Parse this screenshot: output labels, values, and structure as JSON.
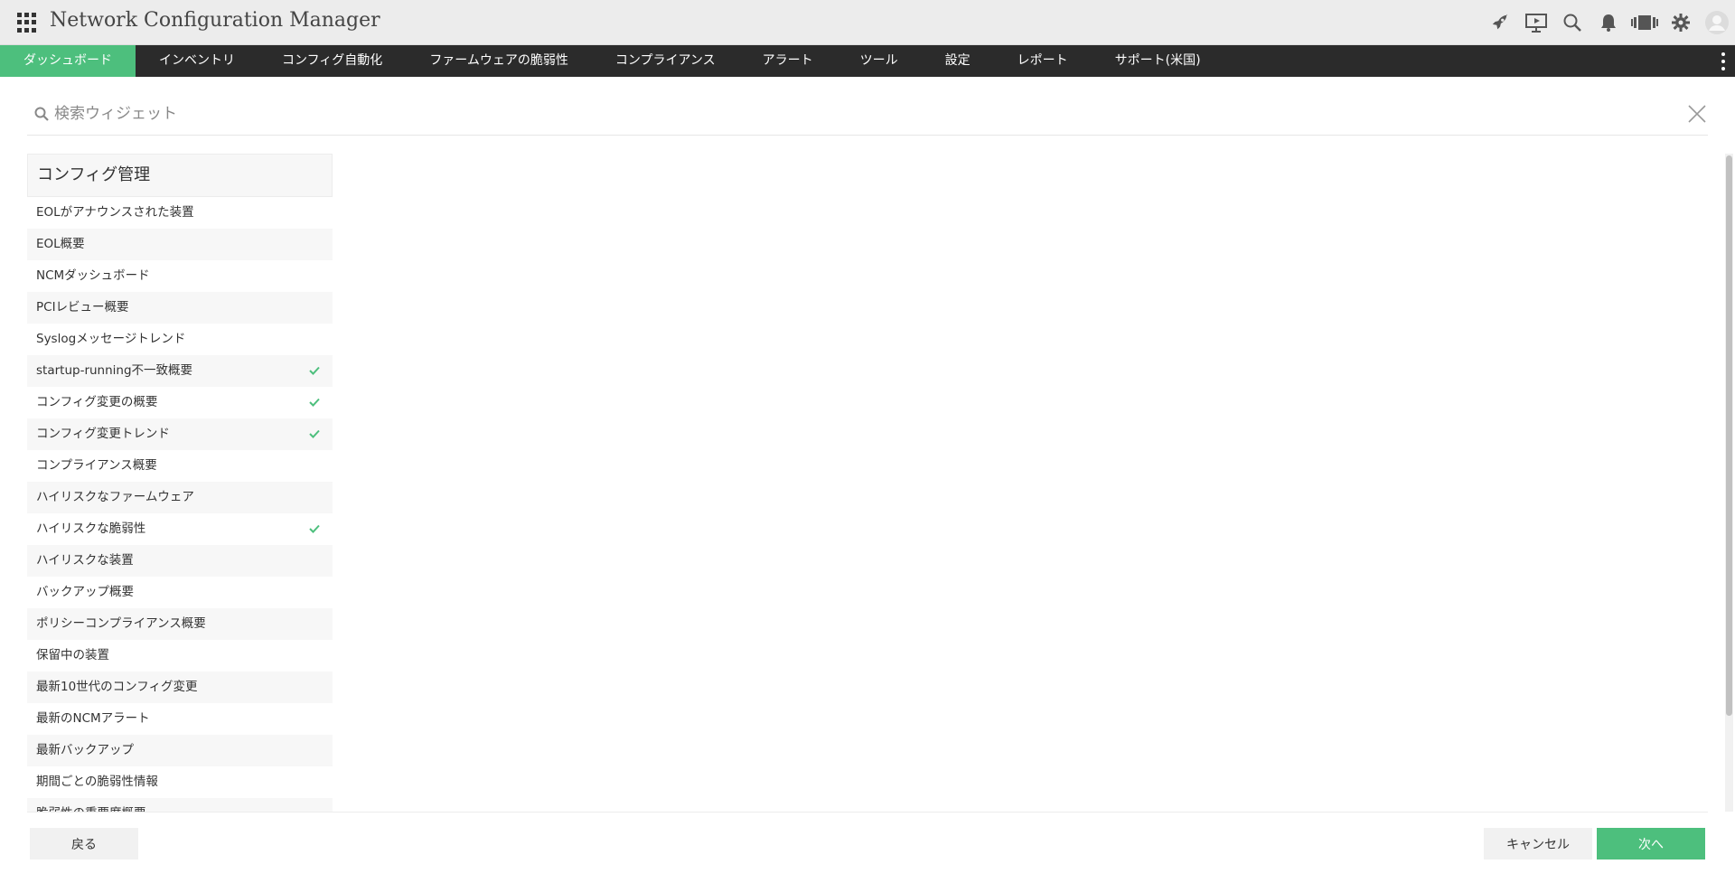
{
  "header": {
    "title": "Network Configuration Manager",
    "icons": [
      "rocket-icon",
      "presentation-icon",
      "search-icon",
      "bell-icon",
      "carousel-icon",
      "gear-icon",
      "user-avatar-icon"
    ]
  },
  "nav": {
    "items": [
      {
        "label": "ダッシュボード",
        "active": true
      },
      {
        "label": "インベントリ"
      },
      {
        "label": "コンフィグ自動化"
      },
      {
        "label": "ファームウェアの脆弱性"
      },
      {
        "label": "コンプライアンス"
      },
      {
        "label": "アラート"
      },
      {
        "label": "ツール"
      },
      {
        "label": "設定"
      },
      {
        "label": "レポート"
      },
      {
        "label": "サポート(米国)"
      }
    ]
  },
  "search": {
    "placeholder": "検索ウィジェット",
    "value": ""
  },
  "category": {
    "title": "コンフィグ管理"
  },
  "widgets": [
    {
      "label": "EOLがアナウンスされた装置",
      "checked": false
    },
    {
      "label": "EOL概要",
      "checked": false
    },
    {
      "label": "NCMダッシュボード",
      "checked": false
    },
    {
      "label": "PCIレビュー概要",
      "checked": false
    },
    {
      "label": "Syslogメッセージトレンド",
      "checked": false
    },
    {
      "label": "startup-running不一致概要",
      "checked": true
    },
    {
      "label": "コンフィグ変更の概要",
      "checked": true
    },
    {
      "label": "コンフィグ変更トレンド",
      "checked": true
    },
    {
      "label": "コンプライアンス概要",
      "checked": false
    },
    {
      "label": "ハイリスクなファームウェア",
      "checked": false
    },
    {
      "label": "ハイリスクな脆弱性",
      "checked": true
    },
    {
      "label": "ハイリスクな装置",
      "checked": false
    },
    {
      "label": "バックアップ概要",
      "checked": false
    },
    {
      "label": "ポリシーコンプライアンス概要",
      "checked": false
    },
    {
      "label": "保留中の装置",
      "checked": false
    },
    {
      "label": "最新10世代のコンフィグ変更",
      "checked": false
    },
    {
      "label": "最新のNCMアラート",
      "checked": false
    },
    {
      "label": "最新バックアップ",
      "checked": false
    },
    {
      "label": "期間ごとの脆弱性情報",
      "checked": false
    },
    {
      "label": "脆弱性の重要度概要",
      "checked": false
    }
  ],
  "footer": {
    "back_label": "戻る",
    "cancel_label": "キャンセル",
    "next_label": "次へ"
  },
  "colors": {
    "accent": "#4dbf7d",
    "navbar": "#2b2b2b",
    "header": "#ececec"
  }
}
